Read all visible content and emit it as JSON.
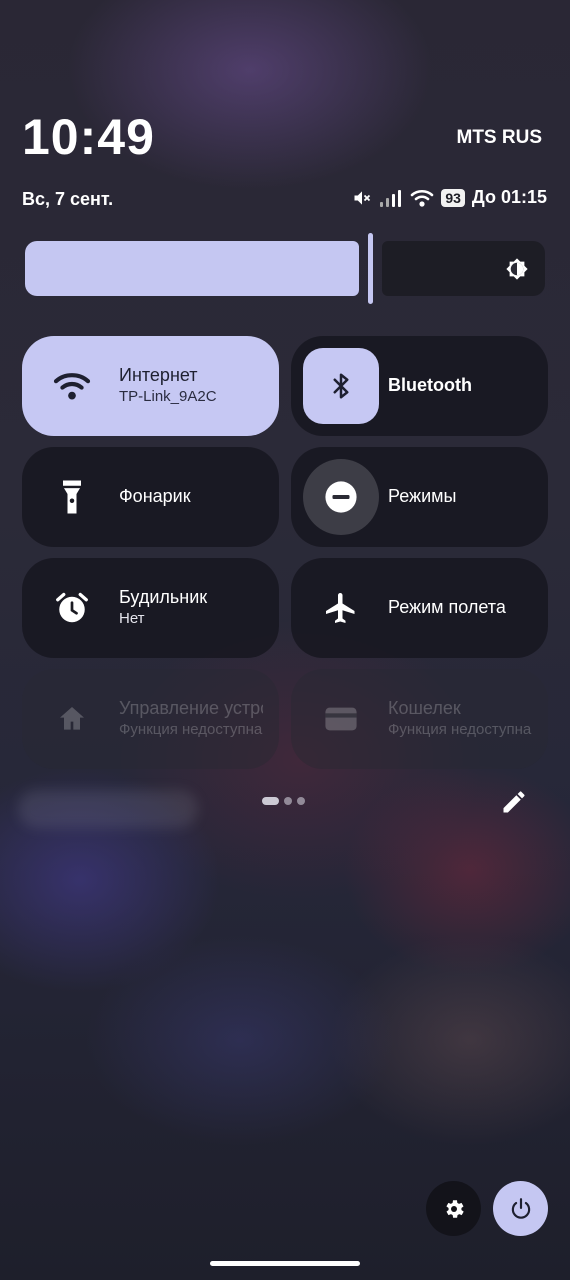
{
  "status": {
    "time": "10:49",
    "carrier": "MTS RUS",
    "date": "Вс, 7 сент.",
    "battery_level": "93",
    "battery_until": "До 01:15",
    "icons": [
      "mute-icon",
      "signal-icon",
      "wifi-icon",
      "battery-icon"
    ]
  },
  "brightness": {
    "level": 0.66,
    "icon": "auto-brightness-icon"
  },
  "tiles": [
    {
      "label": "Интернет",
      "subtitle": "TP-Link_9A2C",
      "icon": "wifi-icon",
      "state": "active"
    },
    {
      "label": "Bluetooth",
      "subtitle": "",
      "icon": "bluetooth-icon",
      "state": "active-icon"
    },
    {
      "label": "Фонарик",
      "subtitle": "",
      "icon": "flashlight-icon",
      "state": "inactive"
    },
    {
      "label": "Режимы",
      "subtitle": "",
      "icon": "do-not-disturb-icon",
      "state": "inactive"
    },
    {
      "label": "Будильник",
      "subtitle": "Нет",
      "icon": "alarm-icon",
      "state": "inactive"
    },
    {
      "label": "Режим полета",
      "subtitle": "",
      "icon": "airplane-icon",
      "state": "inactive"
    },
    {
      "label": "Управление устройствами",
      "subtitle": "Функция недоступна",
      "icon": "home-icon",
      "state": "disabled"
    },
    {
      "label": "Кошелек",
      "subtitle": "Функция недоступна",
      "icon": "wallet-icon",
      "state": "disabled"
    }
  ],
  "pager": {
    "pages": 3,
    "current": 1
  },
  "colors": {
    "accent": "#c6c8f3",
    "tile_inactive": "#1a1a22",
    "text": "#ffffff"
  }
}
